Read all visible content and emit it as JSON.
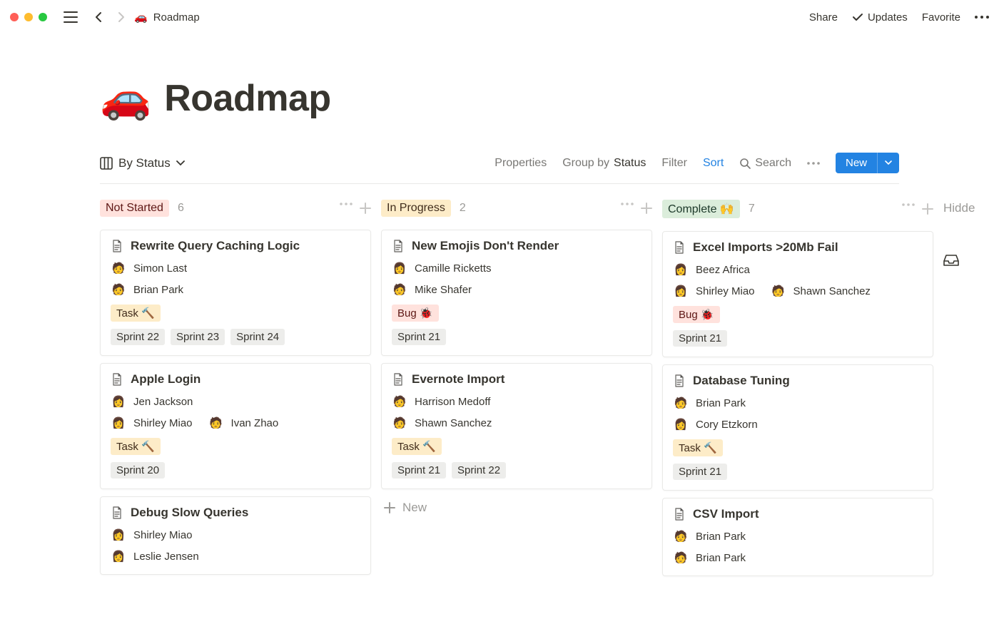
{
  "topbar": {
    "breadcrumb_icon": "🚗",
    "breadcrumb_title": "Roadmap",
    "share": "Share",
    "updates": "Updates",
    "favorite": "Favorite"
  },
  "page": {
    "icon": "🚗",
    "title": "Roadmap"
  },
  "controls": {
    "view_label": "By Status",
    "properties": "Properties",
    "group_by_prefix": "Group by ",
    "group_by_value": "Status",
    "filter": "Filter",
    "sort": "Sort",
    "search": "Search",
    "new": "New"
  },
  "columns": [
    {
      "status_label": "Not Started",
      "pill_class": "pill-red",
      "count": "6",
      "cards": [
        {
          "title": "Rewrite Query Caching Logic",
          "people": [
            {
              "avatar": "🧑",
              "name": "Simon Last"
            },
            {
              "avatar": "🧑",
              "name": "Brian Park"
            }
          ],
          "type_tag": {
            "label": "Task 🔨",
            "class": "tag-task"
          },
          "sprints": [
            "Sprint 22",
            "Sprint 23",
            "Sprint 24"
          ]
        },
        {
          "title": "Apple Login",
          "people": [
            {
              "avatar": "👩",
              "name": "Jen Jackson"
            }
          ],
          "people_inline": [
            {
              "avatar": "👩",
              "name": "Shirley Miao"
            },
            {
              "avatar": "🧑",
              "name": "Ivan Zhao"
            }
          ],
          "type_tag": {
            "label": "Task 🔨",
            "class": "tag-task"
          },
          "sprints": [
            "Sprint 20"
          ]
        },
        {
          "title": "Debug Slow Queries",
          "people": [
            {
              "avatar": "👩",
              "name": "Shirley Miao"
            },
            {
              "avatar": "👩",
              "name": "Leslie Jensen"
            }
          ]
        }
      ]
    },
    {
      "status_label": "In Progress",
      "pill_class": "pill-yellow",
      "count": "2",
      "cards": [
        {
          "title": "New Emojis Don't Render",
          "people": [
            {
              "avatar": "👩",
              "name": "Camille Ricketts"
            },
            {
              "avatar": "🧑",
              "name": "Mike Shafer"
            }
          ],
          "type_tag": {
            "label": "Bug 🐞",
            "class": "tag-bug"
          },
          "sprints": [
            "Sprint 21"
          ]
        },
        {
          "title": "Evernote Import",
          "people": [
            {
              "avatar": "🧑",
              "name": "Harrison Medoff"
            },
            {
              "avatar": "🧑",
              "name": "Shawn Sanchez"
            }
          ],
          "type_tag": {
            "label": "Task 🔨",
            "class": "tag-task"
          },
          "sprints": [
            "Sprint 21",
            "Sprint 22"
          ]
        }
      ],
      "show_new": true,
      "new_label": "New"
    },
    {
      "status_label": "Complete 🙌",
      "pill_class": "pill-green",
      "count": "7",
      "cards": [
        {
          "title": "Excel Imports >20Mb Fail",
          "people": [
            {
              "avatar": "👩",
              "name": "Beez Africa"
            }
          ],
          "people_inline": [
            {
              "avatar": "👩",
              "name": "Shirley Miao"
            },
            {
              "avatar": "🧑",
              "name": "Shawn Sanchez"
            }
          ],
          "type_tag": {
            "label": "Bug 🐞",
            "class": "tag-bug"
          },
          "sprints": [
            "Sprint 21"
          ]
        },
        {
          "title": "Database Tuning",
          "people": [
            {
              "avatar": "🧑",
              "name": "Brian Park"
            },
            {
              "avatar": "👩",
              "name": "Cory Etzkorn"
            }
          ],
          "type_tag": {
            "label": "Task 🔨",
            "class": "tag-task"
          },
          "sprints": [
            "Sprint 21"
          ]
        },
        {
          "title": "CSV Import",
          "people": [
            {
              "avatar": "🧑",
              "name": "Brian Park"
            },
            {
              "avatar": "🧑",
              "name": "Brian Park"
            }
          ]
        }
      ]
    }
  ],
  "hidden_column": {
    "label": "Hidde"
  }
}
